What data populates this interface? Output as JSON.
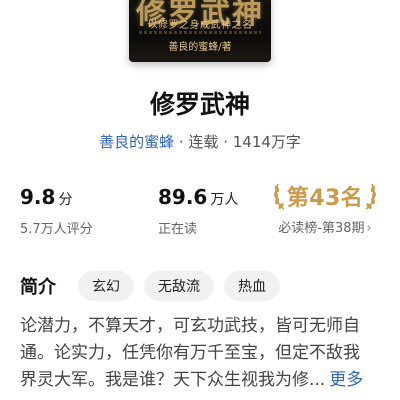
{
  "cover": {
    "title_art": "修罗武神",
    "slogan": "以修罗之身成武神之名",
    "author": "善良的蜜蜂/著"
  },
  "book": {
    "title": "修罗武神",
    "author": "善良的蜜蜂",
    "status": "连载",
    "word_count": "1414万字",
    "separator": " · "
  },
  "stats": {
    "score": {
      "value": "9.8",
      "unit": "分",
      "label": "5.7万人评分"
    },
    "readers": {
      "value": "89.6",
      "unit": "万人",
      "label": "正在读"
    },
    "rank": {
      "value": "第43名",
      "label": "必读榜-第38期",
      "chevron": "›"
    }
  },
  "intro": {
    "label": "简介",
    "tags": [
      "玄幻",
      "无敌流",
      "热血"
    ],
    "lines": [
      "论潜力，不算天才，可玄功武技，皆可无师自",
      "通。论实力，任凭你有万千至宝，但定不敌我",
      "界灵大军。我是谁？天下众生视我为修..."
    ],
    "more_label": "更多"
  },
  "colors": {
    "link": "#2f67b8",
    "rank_gold": "#c99a4a",
    "tag_bg": "#f1f1f1"
  }
}
